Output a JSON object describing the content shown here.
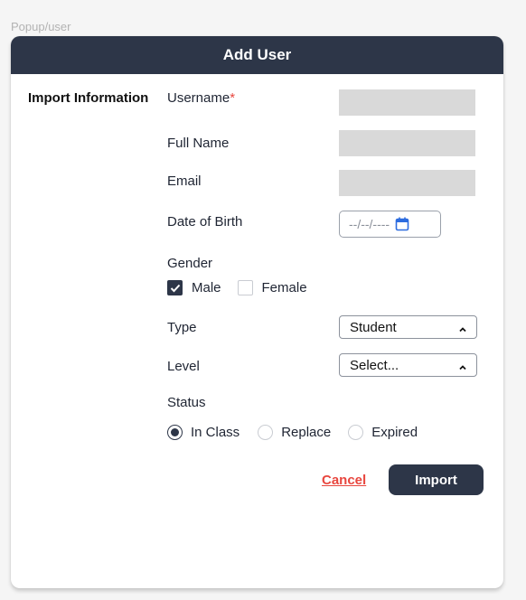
{
  "frame_label": "Popup/user",
  "dialog": {
    "title": "Add User",
    "section_label": "Import Information"
  },
  "fields": {
    "username": {
      "label": "Username",
      "required_mark": "*",
      "value": ""
    },
    "full_name": {
      "label": "Full Name",
      "value": ""
    },
    "email": {
      "label": "Email",
      "value": ""
    },
    "date_of_birth": {
      "label": "Date of Birth",
      "placeholder": "--/--/----"
    },
    "gender": {
      "label": "Gender",
      "options": [
        {
          "label": "Male",
          "checked": true
        },
        {
          "label": "Female",
          "checked": false
        }
      ]
    },
    "type": {
      "label": "Type",
      "selected": "Student"
    },
    "level": {
      "label": "Level",
      "selected": "Select..."
    },
    "status": {
      "label": "Status",
      "options": [
        {
          "label": "In Class",
          "selected": true
        },
        {
          "label": "Replace",
          "selected": false
        },
        {
          "label": "Expired",
          "selected": false
        }
      ]
    }
  },
  "actions": {
    "cancel_label": "Cancel",
    "import_label": "Import"
  },
  "colors": {
    "header_bg": "#2d3648",
    "accent_red": "#e8473f",
    "input_fill": "#d9d9d9"
  },
  "icons": {
    "date": "calendar-icon",
    "select": "chevron-up-icon",
    "checkbox": "checkmark-icon"
  }
}
